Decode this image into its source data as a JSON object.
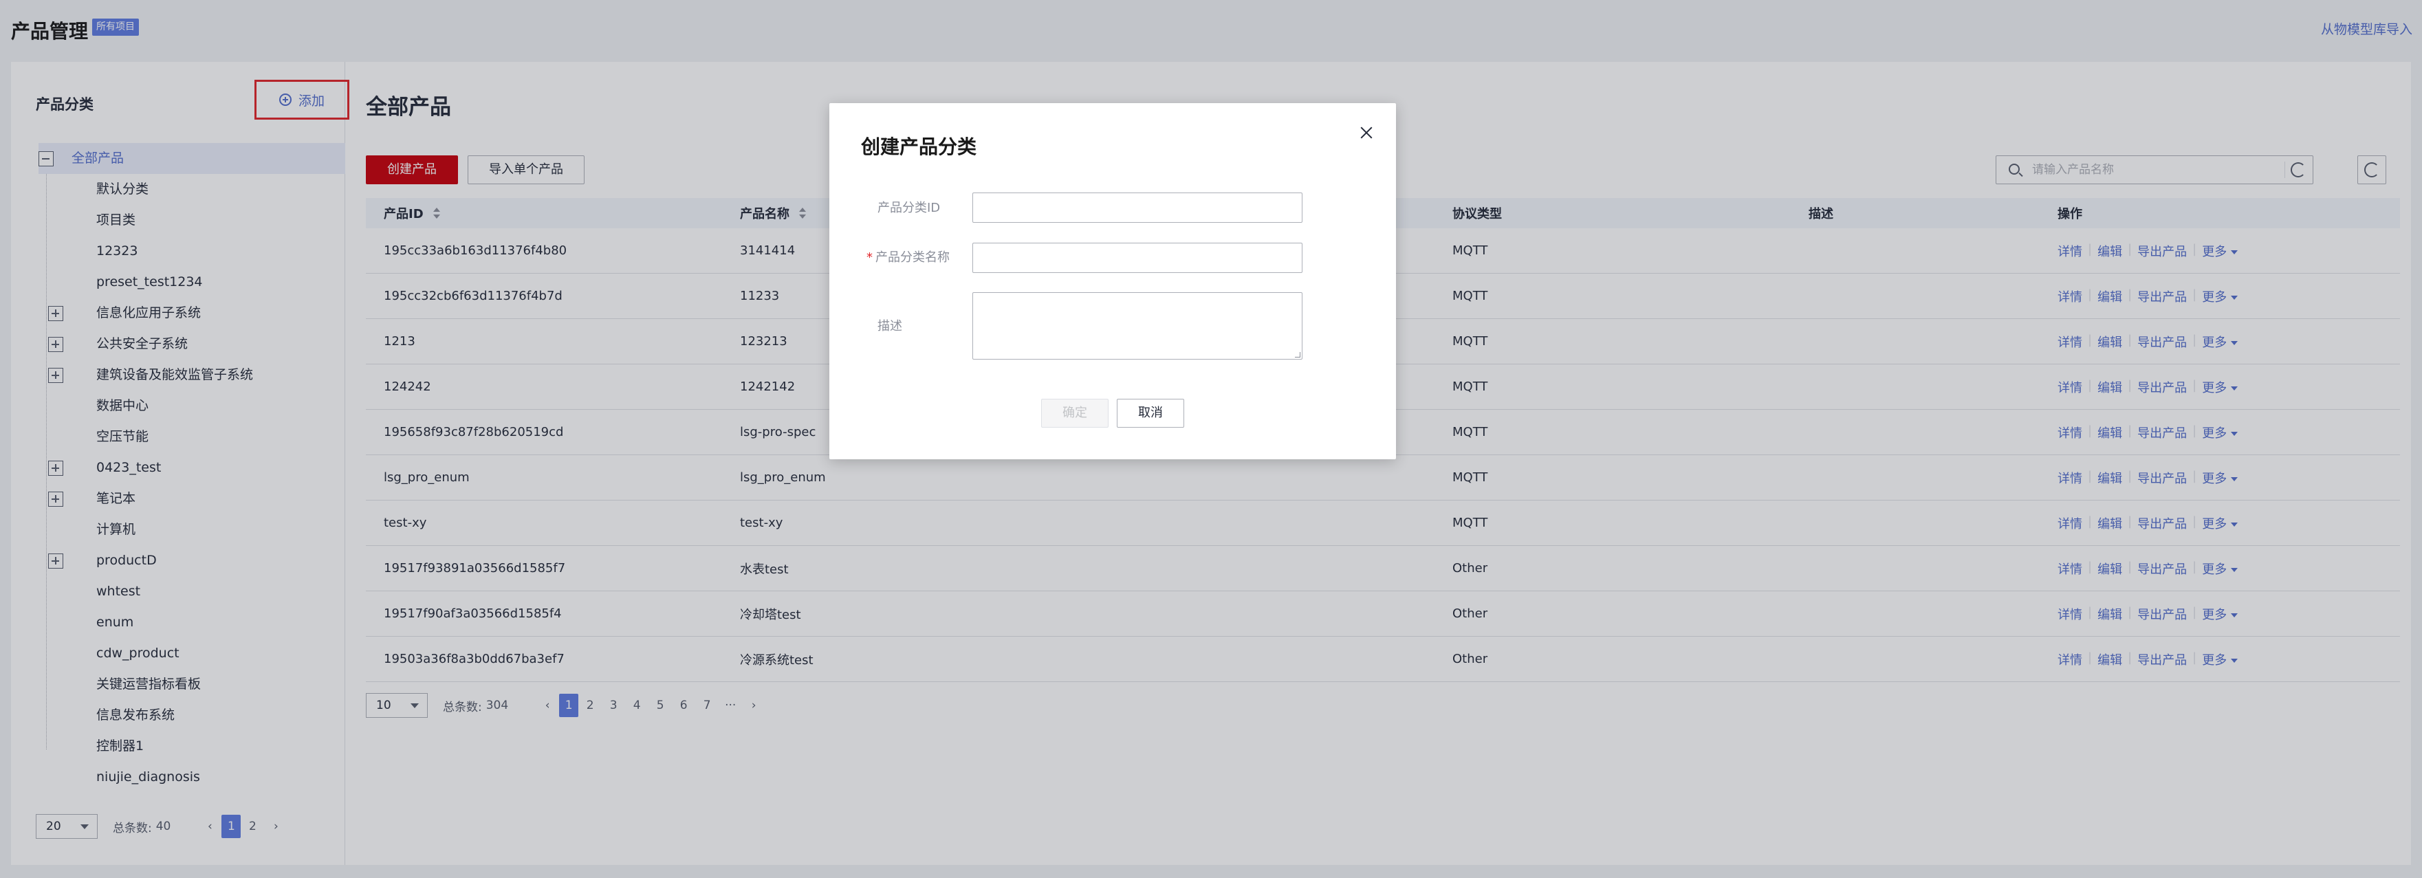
{
  "header": {
    "title": "产品管理",
    "badge": "所有项目",
    "import_link": "从物模型库导入"
  },
  "sidebar": {
    "title": "产品分类",
    "add_label": "添加",
    "items": [
      {
        "label": "全部产品",
        "level": 0,
        "toggle": "minus",
        "selected": true
      },
      {
        "label": "默认分类",
        "level": 1
      },
      {
        "label": "项目类",
        "level": 1
      },
      {
        "label": "12323",
        "level": 1
      },
      {
        "label": "preset_test1234",
        "level": 1
      },
      {
        "label": "信息化应用子系统",
        "level": 1,
        "toggle": "plus"
      },
      {
        "label": "公共安全子系统",
        "level": 1,
        "toggle": "plus"
      },
      {
        "label": "建筑设备及能效监管子系统",
        "level": 1,
        "toggle": "plus"
      },
      {
        "label": "数据中心",
        "level": 1
      },
      {
        "label": "空压节能",
        "level": 1
      },
      {
        "label": "0423_test",
        "level": 1,
        "toggle": "plus"
      },
      {
        "label": "笔记本",
        "level": 1,
        "toggle": "plus"
      },
      {
        "label": "计算机",
        "level": 1
      },
      {
        "label": "productD",
        "level": 1,
        "toggle": "plus"
      },
      {
        "label": "whtest",
        "level": 1
      },
      {
        "label": "enum",
        "level": 1
      },
      {
        "label": "cdw_product",
        "level": 1
      },
      {
        "label": "关键运营指标看板",
        "level": 1
      },
      {
        "label": "信息发布系统",
        "level": 1
      },
      {
        "label": "控制器1",
        "level": 1
      },
      {
        "label": "niujie_diagnosis",
        "level": 1
      }
    ],
    "page_size": "20",
    "total_label": "总条数:",
    "total": "40",
    "pages": [
      "1",
      "2"
    ],
    "current_page": "1"
  },
  "main": {
    "title": "全部产品",
    "create_label": "创建产品",
    "import_label": "导入单个产品",
    "search_placeholder": "请输入产品名称",
    "columns": [
      "产品ID",
      "产品名称",
      "",
      "协议类型",
      "描述",
      "操作"
    ],
    "rows": [
      {
        "id": "195cc33a6b163d11376f4b80",
        "name": "3141414",
        "protocol": "MQTT",
        "desc": ""
      },
      {
        "id": "195cc32cb6f63d11376f4b7d",
        "name": "11233",
        "protocol": "MQTT",
        "desc": ""
      },
      {
        "id": "1213",
        "name": "123213",
        "protocol": "MQTT",
        "desc": ""
      },
      {
        "id": "124242",
        "name": "1242142",
        "protocol": "MQTT",
        "desc": ""
      },
      {
        "id": "195658f93c87f28b620519cd",
        "name": "lsg-pro-spec",
        "protocol": "MQTT",
        "desc": ""
      },
      {
        "id": "lsg_pro_enum",
        "name": "lsg_pro_enum",
        "protocol": "MQTT",
        "desc": ""
      },
      {
        "id": "test-xy",
        "name": "test-xy",
        "protocol": "MQTT",
        "desc": ""
      },
      {
        "id": "19517f93891a03566d1585f7",
        "name": "水表test",
        "protocol": "Other",
        "desc": ""
      },
      {
        "id": "19517f90af3a03566d1585f4",
        "name": "冷却塔test",
        "protocol": "Other",
        "desc": ""
      },
      {
        "id": "19503a36f8a3b0dd67ba3ef7",
        "name": "冷源系统test",
        "protocol": "Other",
        "desc": ""
      }
    ],
    "ops": {
      "detail": "详情",
      "edit": "编辑",
      "export": "导出产品",
      "more": "更多"
    },
    "page_size": "10",
    "total_label": "总条数:",
    "total": "304",
    "pages": [
      "1",
      "2",
      "3",
      "4",
      "5",
      "6",
      "7",
      "···"
    ],
    "current_page": "1"
  },
  "dialog": {
    "title": "创建产品分类",
    "field_id_label": "产品分类ID",
    "field_name_label": "产品分类名称",
    "field_desc_label": "描述",
    "required_mark": "*",
    "ok_label": "确定",
    "cancel_label": "取消"
  }
}
